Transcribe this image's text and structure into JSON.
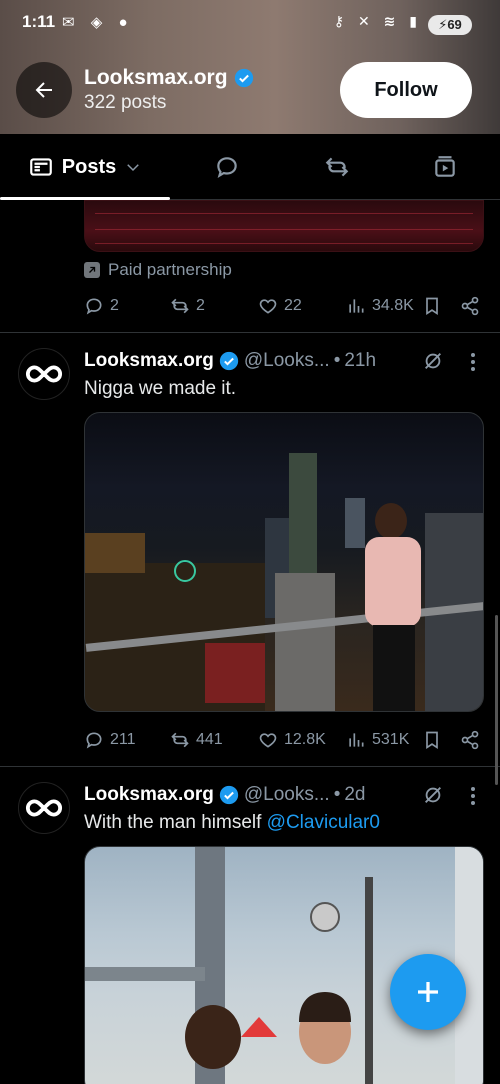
{
  "status_bar": {
    "time": "1:11",
    "battery": "69"
  },
  "header": {
    "profile_name": "Looksmax.org",
    "post_count": "322 posts",
    "follow_label": "Follow"
  },
  "tabs": [
    {
      "label": "Posts",
      "icon": "posts-icon"
    },
    {
      "icon": "replies-icon"
    },
    {
      "icon": "reposts-icon"
    },
    {
      "icon": "media-icon"
    }
  ],
  "posts": [
    {
      "partnership": "Paid partnership",
      "stats": {
        "replies": "2",
        "reposts": "2",
        "likes": "22",
        "views": "34.8K"
      }
    },
    {
      "name": "Looksmax.org",
      "handle": "@Looks...",
      "time": "21h",
      "text": "Nigga we made it.",
      "stats": {
        "replies": "211",
        "reposts": "441",
        "likes": "12.8K",
        "views": "531K"
      }
    },
    {
      "name": "Looksmax.org",
      "handle": "@Looks...",
      "time": "2d",
      "text": "With the man himself ",
      "mention": "@Clavicular0"
    }
  ],
  "colors": {
    "accent": "#1d9bf0",
    "background": "#000000",
    "muted": "#8b98a5"
  }
}
